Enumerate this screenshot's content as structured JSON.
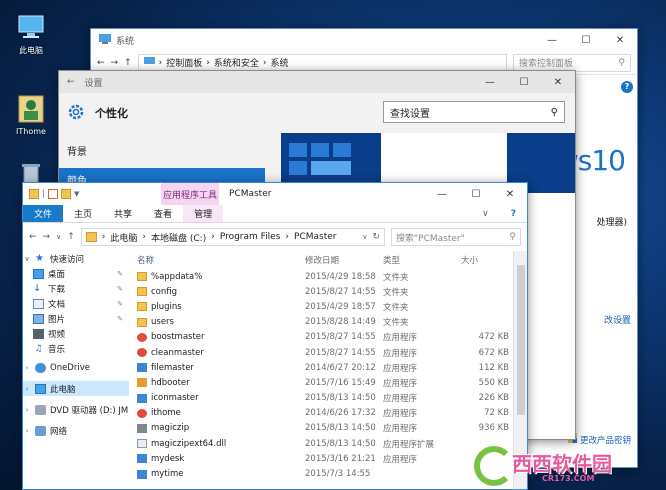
{
  "desktop": {
    "icons": [
      {
        "label": "此电脑"
      },
      {
        "label": "IThome"
      },
      {
        "label": ""
      }
    ]
  },
  "system_window": {
    "title": "系统",
    "breadcrumb": [
      "控制面板",
      "系统和安全",
      "系统"
    ],
    "search_placeholder": "搜索控制面板",
    "logo_text": "ws10",
    "side_text_1": "处理器)",
    "side_link_settings": "改设置",
    "side_link_key": "更改产品密钥"
  },
  "settings_window": {
    "title": "设置",
    "page_title": "个性化",
    "search_placeholder": "查找设置",
    "nav_items": [
      "背景",
      "颜色"
    ]
  },
  "explorer": {
    "context_tab": "应用程序工具",
    "title": "PCMaster",
    "ribbon_tabs": [
      "文件",
      "主页",
      "共享",
      "查看",
      "管理"
    ],
    "address": [
      "此电脑",
      "本地磁盘 (C:)",
      "Program Files",
      "PCMaster"
    ],
    "search_placeholder": "搜索\"PCMaster\"",
    "nav_pane": [
      {
        "label": "快速访问",
        "icon": "star-icon",
        "chev": "v"
      },
      {
        "label": "桌面",
        "icon": "desktop-icon",
        "pinned": true
      },
      {
        "label": "下载",
        "icon": "download-icon",
        "pinned": true
      },
      {
        "label": "文档",
        "icon": "documents-icon",
        "pinned": true
      },
      {
        "label": "图片",
        "icon": "pictures-icon",
        "pinned": true
      },
      {
        "label": "视频",
        "icon": "videos-icon"
      },
      {
        "label": "音乐",
        "icon": "music-icon"
      },
      {
        "label": "OneDrive",
        "icon": "cloud-icon",
        "chev": ">"
      },
      {
        "label": "此电脑",
        "icon": "this-pc-icon",
        "chev": ">",
        "selected": true
      },
      {
        "label": "DVD 驱动器 (D:) JM",
        "icon": "dvd-icon",
        "chev": ">"
      },
      {
        "label": "网络",
        "icon": "network-icon",
        "chev": ">"
      }
    ],
    "columns": [
      "名称",
      "修改日期",
      "类型",
      "大小"
    ],
    "files": [
      {
        "name": "%appdata%",
        "date": "2015/4/29 18:58",
        "type": "文件夹",
        "size": "",
        "icon": "folder"
      },
      {
        "name": "config",
        "date": "2015/8/27 14:55",
        "type": "文件夹",
        "size": "",
        "icon": "folder"
      },
      {
        "name": "plugins",
        "date": "2015/4/29 18:57",
        "type": "文件夹",
        "size": "",
        "icon": "folder"
      },
      {
        "name": "users",
        "date": "2015/8/28 14:49",
        "type": "文件夹",
        "size": "",
        "icon": "folder"
      },
      {
        "name": "boostmaster",
        "date": "2015/8/27 14:55",
        "type": "应用程序",
        "size": "472 KB",
        "icon": "app-red"
      },
      {
        "name": "cleanmaster",
        "date": "2015/8/27 14:55",
        "type": "应用程序",
        "size": "672 KB",
        "icon": "app-red"
      },
      {
        "name": "filemaster",
        "date": "2014/6/27 20:12",
        "type": "应用程序",
        "size": "112 KB",
        "icon": "app-blue"
      },
      {
        "name": "hdbooter",
        "date": "2015/7/16 15:49",
        "type": "应用程序",
        "size": "550 KB",
        "icon": "app-orange"
      },
      {
        "name": "iconmaster",
        "date": "2015/8/13 14:50",
        "type": "应用程序",
        "size": "226 KB",
        "icon": "app-blue"
      },
      {
        "name": "ithome",
        "date": "2014/6/26 17:32",
        "type": "应用程序",
        "size": "72 KB",
        "icon": "app-red"
      },
      {
        "name": "magiczip",
        "date": "2015/8/13 14:50",
        "type": "应用程序",
        "size": "936 KB",
        "icon": "app-gray"
      },
      {
        "name": "magiczipext64.dll",
        "date": "2015/8/13 14:50",
        "type": "应用程序扩展",
        "size": "",
        "icon": "dll"
      },
      {
        "name": "mydesk",
        "date": "2015/3/16 21:21",
        "type": "应用程序",
        "size": "",
        "icon": "app-blue"
      },
      {
        "name": "mytime",
        "date": "2015/7/3 14:55",
        "type": "",
        "size": "",
        "icon": "app-blue"
      }
    ]
  },
  "watermark": {
    "text": "西西软件园",
    "sub": "CR173.COM"
  }
}
